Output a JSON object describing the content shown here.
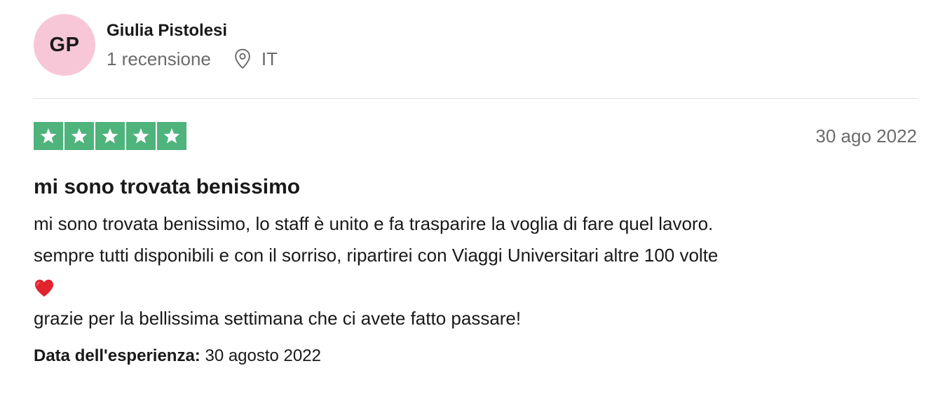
{
  "consumer": {
    "initials": "GP",
    "name": "Giulia Pistolesi",
    "review_count": "1 recensione",
    "country": "IT",
    "avatar_color": "#f7c7d8"
  },
  "review": {
    "rating": 5,
    "rating_max": 5,
    "star_color": "#4fb37c",
    "date": "30 ago 2022",
    "title": "mi sono trovata benissimo",
    "body_lines": [
      "mi sono trovata benissimo, lo staff è unito e fa trasparire la voglia di fare quel lavoro.",
      "sempre tutti disponibili e con il sorriso, ripartirei con Viaggi Universitari altre 100 volte",
      "grazie per la bellissima settimana che ci avete fatto passare!"
    ],
    "heart_icon": "red-heart-icon",
    "experience_label": "Data dell'esperienza:",
    "experience_date": "30 agosto 2022"
  }
}
